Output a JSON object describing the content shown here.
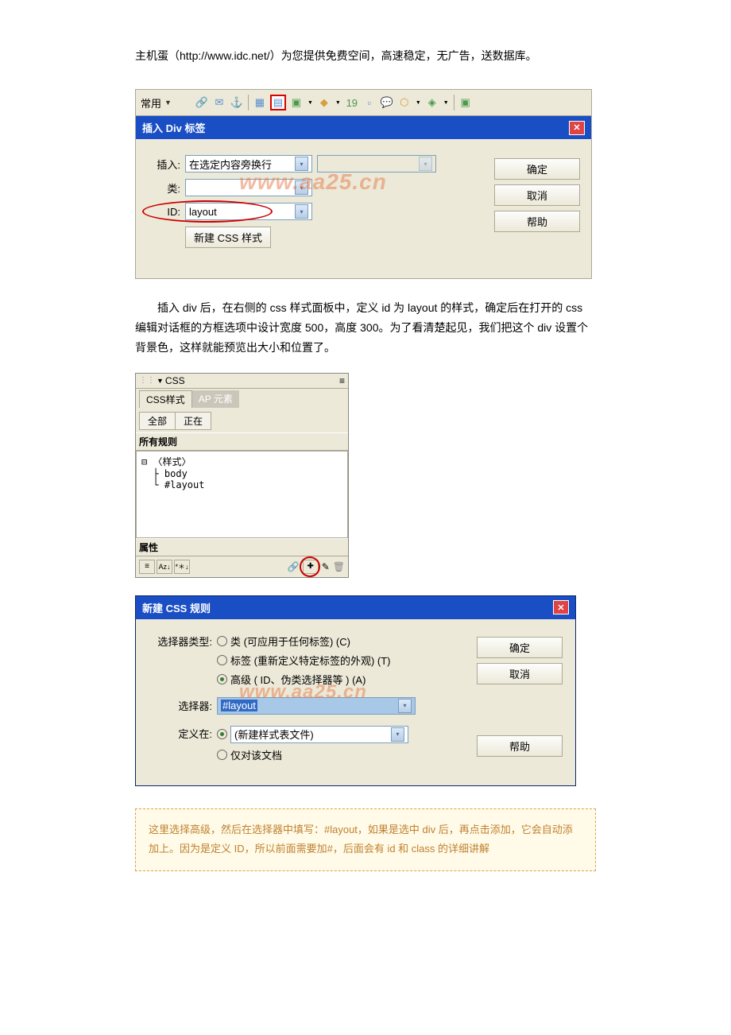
{
  "header": "主机蛋（http://www.idc.net/）为您提供免费空间，高速稳定，无广告，送数据库。",
  "dialog1": {
    "toolbar_label": "常用",
    "title": "插入 Div 标签",
    "insert_label": "插入:",
    "insert_value": "在选定内容旁换行",
    "class_label": "类:",
    "id_label": "ID:",
    "id_value": "layout",
    "newcss_btn": "新建 CSS 样式",
    "ok": "确定",
    "cancel": "取消",
    "help": "帮助",
    "watermark": "www.aa25.cn"
  },
  "para1": "插入 div 后，在右侧的 css 样式面板中，定义 id 为 layout 的样式，确定后在打开的 css 编辑对话框的方框选项中设计宽度 500，高度 300。为了看清楚起见，我们把这个 div 设置个背景色，这样就能预览出大小和位置了。",
  "csspanel": {
    "hdr": "CSS",
    "tab1": "CSS样式",
    "tab2": "AP 元素",
    "sub1": "全部",
    "sub2": "正在",
    "rules_h": "所有规则",
    "tree_line1": "〈样式〉",
    "tree_line2": "body",
    "tree_line3": "#layout",
    "props_h": "属性"
  },
  "dialog2": {
    "title": "新建 CSS 规则",
    "seltype_label": "选择器类型:",
    "opt1": "类 (可应用于任何标签) (C)",
    "opt2": "标签 (重新定义特定标签的外观) (T)",
    "opt3": "高级 ( ID、伪类选择器等 ) (A)",
    "selector_label": "选择器:",
    "selector_value": "#layout",
    "define_label": "定义在:",
    "define_opt1": "(新建样式表文件)",
    "define_opt2": "仅对该文档",
    "ok": "确定",
    "cancel": "取消",
    "help": "帮助",
    "watermark": "www.aa25.cn"
  },
  "note": "这里选择高级，然后在选择器中填写：#layout，如果是选中 div 后，再点击添加，它会自动添加上。因为是定义 ID，所以前面需要加#，后面会有 id 和 class 的详细讲解"
}
